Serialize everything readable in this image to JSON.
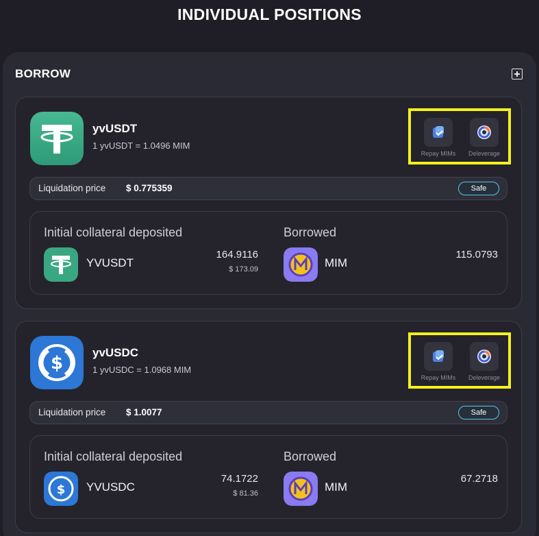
{
  "page": {
    "title": "INDIVIDUAL POSITIONS"
  },
  "borrow": {
    "title": "BORROW",
    "positions": [
      {
        "token": "yvUSDT",
        "rate": "1 yvUSDT = 1.0496 MIM",
        "actions": {
          "repay": "Repay MIMs",
          "deleverage": "Deleverage"
        },
        "liquidation": {
          "label": "Liquidation price",
          "value": "$ 0.775359",
          "status": "Safe"
        },
        "collateral": {
          "label": "Initial collateral deposited",
          "asset": "YVUSDT",
          "amount": "164.9116",
          "usd": "$ 173.09"
        },
        "borrowed": {
          "label": "Borrowed",
          "asset": "MIM",
          "amount": "115.0793"
        },
        "icon": "tether-icon",
        "icon_color": "#3aa783"
      },
      {
        "token": "yvUSDC",
        "rate": "1 yvUSDC = 1.0968 MIM",
        "actions": {
          "repay": "Repay MIMs",
          "deleverage": "Deleverage"
        },
        "liquidation": {
          "label": "Liquidation price",
          "value": "$ 1.0077",
          "status": "Safe"
        },
        "collateral": {
          "label": "Initial collateral deposited",
          "asset": "YVUSDC",
          "amount": "74.1722",
          "usd": "$ 81.36"
        },
        "borrowed": {
          "label": "Borrowed",
          "asset": "MIM",
          "amount": "67.2718"
        },
        "icon": "usdc-icon",
        "icon_color": "#2d77d6"
      }
    ]
  },
  "colors": {
    "highlight": "#f7f01b",
    "safe_border": "#5fc3f0",
    "mim": "#8a7bf2"
  }
}
